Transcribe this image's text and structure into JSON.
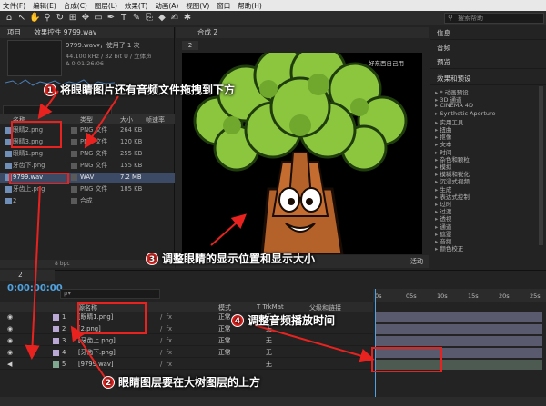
{
  "menu": [
    "文件(F)",
    "编辑(E)",
    "合成(C)",
    "图层(L)",
    "效果(T)",
    "动画(A)",
    "视图(V)",
    "窗口",
    "帮助(H)"
  ],
  "toolbar": {
    "search_placeholder": "搜索帮助"
  },
  "project": {
    "tab": "项目",
    "comp_tab": "效果控件 9799.wav",
    "file_name": "9799.wav▾，使用了 1 次",
    "file_info": "44.100 kHz / 32 bit U / 立体声",
    "file_time": "Δ 0:01:26:06",
    "columns": [
      "名称",
      "类型",
      "大小",
      "帧速率"
    ],
    "rows": [
      {
        "name": "眼睛2.png",
        "type": "PNG 文件",
        "size": "264 KB",
        "sel": false
      },
      {
        "name": "眼睛3.png",
        "type": "PNG 文件",
        "size": "120 KB",
        "sel": false
      },
      {
        "name": "眼睛1.png",
        "type": "PNG 文件",
        "size": "255 KB",
        "sel": false
      },
      {
        "name": "牙齿下.png",
        "type": "PNG 文件",
        "size": "155 KB",
        "sel": false
      },
      {
        "name": "9799.wav",
        "type": "WAV",
        "size": "7.2 MB",
        "sel": true
      },
      {
        "name": "牙齿上.png",
        "type": "PNG 文件",
        "size": "185 KB",
        "sel": false
      },
      {
        "name": "2",
        "type": "合成",
        "size": "",
        "sel": false
      }
    ],
    "footer": "8 bpc"
  },
  "composition": {
    "tab": "合成 2",
    "sub_tab": "2",
    "watermark": "好东西自己用",
    "footer_label": "活动"
  },
  "right_panel": {
    "panels": [
      "信息",
      "音频",
      "预览",
      "效果和预设"
    ],
    "search_placeholder": "",
    "effects": [
      "* 动画预设",
      "3D 通道",
      "CINEMA 4D",
      "Synthetic Aperture",
      "实用工具",
      "扭曲",
      "抠像",
      "文本",
      "时间",
      "杂色和颗粒",
      "模拟",
      "模糊和锐化",
      "沉浸式视频",
      "生成",
      "表达式控制",
      "过时",
      "过渡",
      "透视",
      "通道",
      "遮罩",
      "音频",
      "颜色校正"
    ]
  },
  "timeline": {
    "tab": "2",
    "timecode": "0:00:00:00",
    "search_placeholder": "ρ▾",
    "header": {
      "source": "源名称",
      "mode": "模式",
      "track": "T  TrkMat",
      "parent": "父级和链接"
    },
    "layers": [
      {
        "num": "1",
        "name": "[眼睛1.png]",
        "mode": "正常",
        "track": "无",
        "label_color": "#b9a7d6"
      },
      {
        "num": "2",
        "name": "[2.png]",
        "mode": "正常",
        "track": "无",
        "label_color": "#b9a7d6"
      },
      {
        "num": "3",
        "name": "[牙齿上.png]",
        "mode": "正常",
        "track": "无",
        "label_color": "#b9a7d6"
      },
      {
        "num": "4",
        "name": "[牙齿下.png]",
        "mode": "正常",
        "track": "无",
        "label_color": "#b9a7d6"
      },
      {
        "num": "5",
        "name": "[9799.wav]",
        "mode": "",
        "track": "无",
        "label_color": "#7fa890"
      }
    ],
    "ruler_ticks": [
      "0s",
      "05s",
      "10s",
      "15s",
      "20s",
      "25s"
    ]
  },
  "annotations": [
    {
      "num": "1",
      "text": "将眼睛图片还有音频文件拖拽到下方"
    },
    {
      "num": "2",
      "text": "眼睛图层要在大树图层的上方"
    },
    {
      "num": "3",
      "text": "调整眼睛的显示位置和显示大小"
    },
    {
      "num": "4",
      "text": "调整音频播放时间"
    }
  ],
  "colors": {
    "accent": "#4fa3e0",
    "annotation_red": "#e8231f"
  }
}
